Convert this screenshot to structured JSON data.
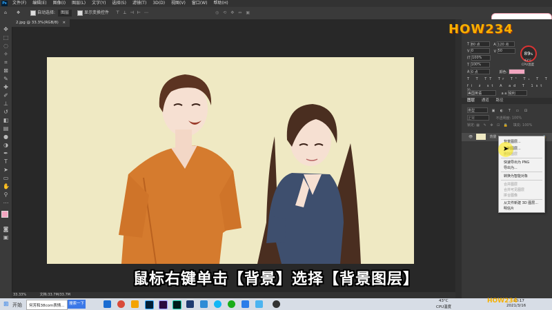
{
  "menubar": {
    "app_icon": "Ps",
    "menus": [
      "文件(F)",
      "编辑(E)",
      "图像(I)",
      "图层(L)",
      "文字(Y)",
      "选择(S)",
      "滤镜(T)",
      "3D(D)",
      "视图(V)",
      "窗口(W)",
      "帮助(H)"
    ],
    "window_buttons": [
      "—",
      "☐",
      "✕"
    ]
  },
  "options_bar": {
    "auto_select_label": "自动选择:",
    "auto_select_value": "图层",
    "show_transform_label": "显示变换控件"
  },
  "document": {
    "tab_title": "2.jpg @ 33.3%(RGB/8)",
    "tab_close": "×"
  },
  "subtitle": "鼠标右键单击【背景】选择【背景图层】",
  "status": {
    "zoom": "33.33%",
    "doc_info": "文档:33.7M/33.7M"
  },
  "character_panel": {
    "font_size": "80 点",
    "leading": "120 点",
    "kerning": "0",
    "tracking": "50",
    "vscale": "100%",
    "hscale": "100%",
    "baseline": "0 点",
    "color_label": "颜色:",
    "color_value": "#f2a6c0",
    "language": "美国英语",
    "antialias": "锐利",
    "aa_prefix": "a a"
  },
  "layers_panel": {
    "tabs": [
      "图层",
      "通道",
      "路径"
    ],
    "filter_label": "类型",
    "mode": "正常",
    "opacity_label": "不透明度:",
    "opacity_value": "100%",
    "lock_label": "锁定:",
    "fill_label": "填充:",
    "fill_value": "100%",
    "layer_name": "背景"
  },
  "context_menu": {
    "items": [
      {
        "label": "背景图层...",
        "enabled": true
      },
      {
        "label": "复制图层...",
        "enabled": true
      },
      {
        "label": "删除图层",
        "enabled": false
      },
      {
        "label": "快速导出为 PNG",
        "enabled": true
      },
      {
        "label": "导出为...",
        "enabled": true
      },
      {
        "label": "转换为智能对象",
        "enabled": true
      },
      {
        "label": "合并图层",
        "enabled": false
      },
      {
        "label": "合并可见图层",
        "enabled": false
      },
      {
        "label": "拼合图像",
        "enabled": false
      },
      {
        "label": "从文件新建 3D 图层...",
        "enabled": true
      },
      {
        "label": "明信片",
        "enabled": true
      }
    ]
  },
  "watermark": {
    "text": "HOW234"
  },
  "cpu": {
    "value": "89",
    "unit": "%",
    "temp": "43°C",
    "label": "CPU温度"
  },
  "taskbar": {
    "start": "开始",
    "task1": "何芳和38com表情...",
    "search_button": "搜索一下",
    "temperature": "43°C",
    "cpu_label": "CPU温度",
    "time": "10:17",
    "date": "2021/3/16"
  },
  "colors": {
    "canvas_bg": "#efe9c3",
    "swatch_fg": "#f2a6c0",
    "accent": "#31a8ff"
  }
}
